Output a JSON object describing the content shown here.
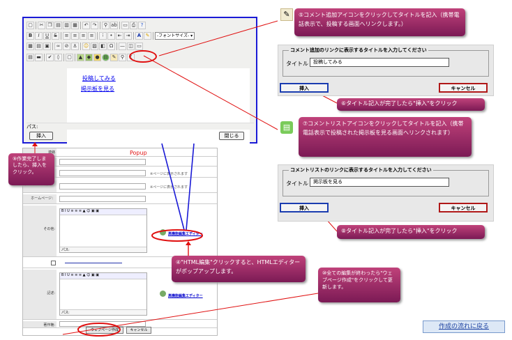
{
  "editor": {
    "toolbar": {
      "font_size_select": "-フォントサイズ-"
    },
    "links": [
      "投稿してみる",
      "掲示板を見る"
    ],
    "path_label": "パス:",
    "insert_button": "挿入",
    "close_button": "閉じる"
  },
  "form": {
    "header_label": "連絡",
    "popup_label": "Popup",
    "rows": [
      {
        "label": "",
        "note": ""
      },
      {
        "label": "",
        "note": "※ページに表示されます"
      },
      {
        "label": "ホームページ紹介：",
        "note": "※ページに表示されます"
      },
      {
        "label": "ホームページ：",
        "note": ""
      }
    ],
    "other_label": "その他:",
    "note_label": "記述:",
    "author_label": "著作権:",
    "advanced_editor_link": "高機能編集エディター",
    "mini_path": "パス:",
    "create_button": "ウェブページ作成",
    "cancel_button": "キャンセル"
  },
  "callouts": {
    "c5": "⑤コメント追加アイコンをクリックしてタイトルを記入（携帯電話表示で、投稿する画面へリンクします。）",
    "c6": "⑥タイトル記入が完了したら\"挿入\"をクリック",
    "c7": "⑦コメントリストアイコンをクリックしてタイトルを記入（携帯電話表示で投稿された掲示板を見る画面へリンクされます）",
    "c8": "⑧タイトル記入が完了したら\"挿入\"をクリック",
    "c9": "⑨作業完了しましたら、挿入をクリック。",
    "c4": "④\"HTML編集\"クリックすると、HTMLエディターがポップアップします。",
    "c10": "⑩全ての編集が終わったら\"ウェブページ作成\"をクリックして更新します。"
  },
  "dialog1": {
    "legend": "コメント追加のリンクに表示するタイトルを入力してください",
    "title_label": "タイトル",
    "title_value": "投稿してみる",
    "insert_button": "挿入",
    "cancel_button": "キャンセル"
  },
  "dialog2": {
    "legend": "コメントリストのリンクに表示するタイトルを入力してください",
    "title_label": "タイトル",
    "title_value": "掲示板を見る",
    "insert_button": "挿入",
    "cancel_button": "キャンセル"
  },
  "flow_link": "作成の流れに戻る",
  "colors": {
    "callout_top": "#c0427a",
    "callout_bottom": "#7b1a55",
    "editor_border": "#1a1ad6",
    "arrow_red": "#e01010",
    "insert_button_border": "#1a3cb0",
    "cancel_button_border": "#b01818"
  }
}
